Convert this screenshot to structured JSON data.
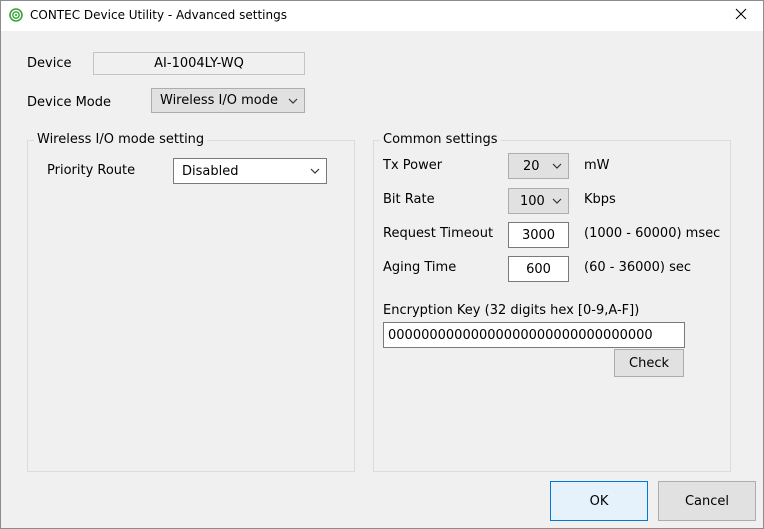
{
  "window": {
    "title": "CONTEC Device Utility - Advanced settings",
    "close_icon": "close-icon",
    "app_icon": "contec-app-icon"
  },
  "device": {
    "label": "Device",
    "value": "AI-1004LY-WQ"
  },
  "device_mode": {
    "label": "Device Mode",
    "selected": "Wireless I/O mode"
  },
  "wireless_group": {
    "caption": "Wireless I/O mode setting",
    "priority_route_label": "Priority Route",
    "priority_route_value": "Disabled"
  },
  "common_group": {
    "caption": "Common settings",
    "tx_power": {
      "label": "Tx Power",
      "value": "20",
      "unit": "mW"
    },
    "bit_rate": {
      "label": "Bit Rate",
      "value": "100",
      "unit": "Kbps"
    },
    "request_timeout": {
      "label": "Request Timeout",
      "value": "3000",
      "range": "(1000 - 60000) msec"
    },
    "aging_time": {
      "label": "Aging Time",
      "value": "600",
      "range": "(60 - 36000) sec"
    },
    "encryption_key": {
      "label": "Encryption Key (32 digits hex [0-9,A-F])",
      "value": "00000000000000000000000000000000"
    },
    "check_label": "Check"
  },
  "footer": {
    "ok_label": "OK",
    "cancel_label": "Cancel"
  }
}
